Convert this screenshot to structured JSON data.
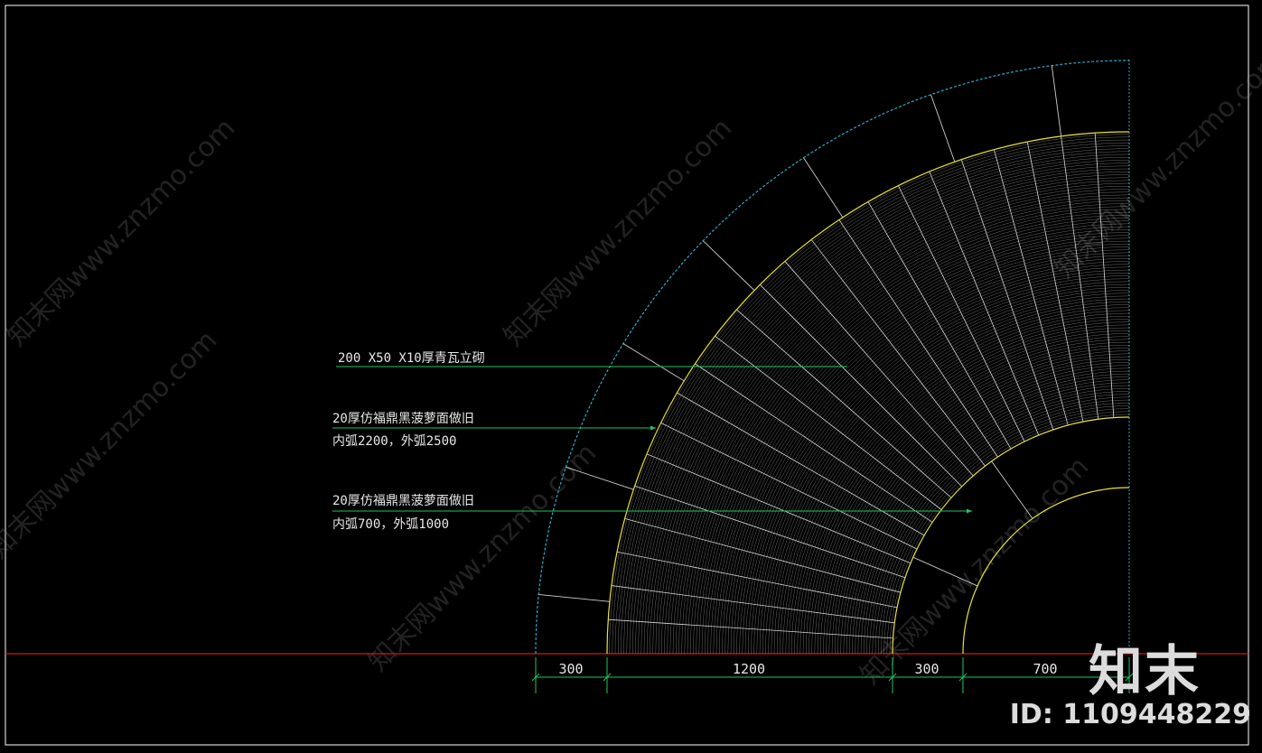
{
  "drawing": {
    "annotations": [
      {
        "lines": [
          "200 X50 X10厚青瓦立砌"
        ]
      },
      {
        "lines": [
          "20厚仿福鼎黑菠萝面做旧",
          "内弧2200，外弧2500"
        ]
      },
      {
        "lines": [
          "20厚仿福鼎黑菠萝面做旧",
          "内弧700，外弧1000"
        ]
      }
    ],
    "dimensions": [
      "300",
      "1200",
      "300",
      "700"
    ],
    "watermark_text": "知末网www.znzmo.com",
    "colors": {
      "background": "#000000",
      "border": "#ffffff",
      "outer_arc": "#2fa8c8",
      "band_arcs": "#e8e23a",
      "tile_hatch": "#cfcfcf",
      "leader": "#22c55e",
      "baseline": "#d01818",
      "text": "#e8e8e8"
    }
  },
  "brand": {
    "logo": "知末",
    "id_label": "ID: 1109448229"
  }
}
